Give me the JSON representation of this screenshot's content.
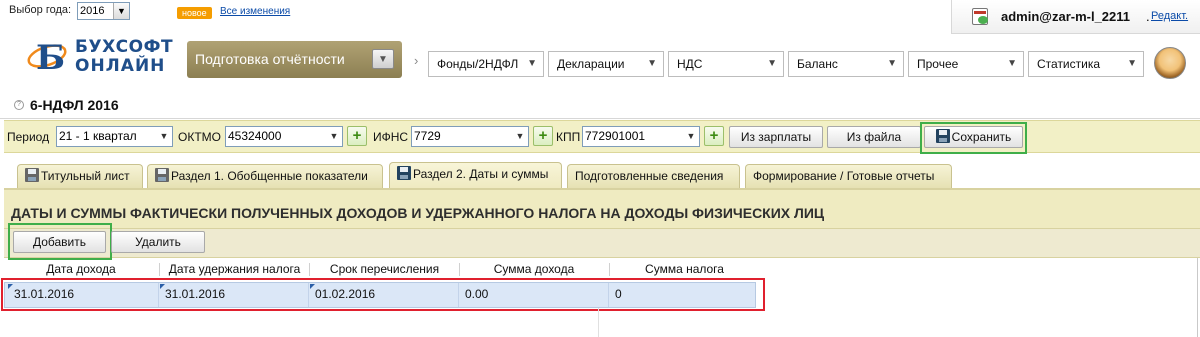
{
  "topbar": {
    "year_label": "Выбор года:",
    "year_value": "2016",
    "new_badge": "новое",
    "changes_link": "Все изменения"
  },
  "user": {
    "name": "admin@zar-m-l_2211",
    "separator": ".",
    "edit_link": "Редакт."
  },
  "logo": {
    "line1": "БУХСОФТ",
    "line2": "ОНЛАЙН"
  },
  "nav": {
    "report_button": "Подготовка отчётности",
    "chevron": "›",
    "items": [
      {
        "label": "Фонды/2НДФЛ"
      },
      {
        "label": "Декларации"
      },
      {
        "label": "НДС"
      },
      {
        "label": "Баланс"
      },
      {
        "label": "Прочее"
      },
      {
        "label": "Статистика"
      }
    ]
  },
  "page": {
    "title": "6-НДФЛ 2016"
  },
  "filters": {
    "period_label": "Период",
    "period_value": "21 - 1 квартал",
    "oktmo_label": "ОКТМО",
    "oktmo_value": "45324000",
    "ifns_label": "ИФНС",
    "ifns_value": "7729",
    "kpp_label": "КПП",
    "kpp_value": "772901001",
    "from_salary": "Из зарплаты",
    "from_file": "Из файла",
    "save": "Сохранить"
  },
  "tabs": [
    {
      "label": "Титульный лист",
      "active": false
    },
    {
      "label": "Раздел 1. Обобщенные показатели",
      "active": false
    },
    {
      "label": "Раздел 2. Даты и суммы",
      "active": true
    },
    {
      "label": "Подготовленные сведения",
      "active": false
    },
    {
      "label": "Формирование / Готовые отчеты",
      "active": false
    }
  ],
  "section": {
    "title": "ДАТЫ И СУММЫ ФАКТИЧЕСКИ ПОЛУЧЕННЫХ ДОХОДОВ И УДЕРЖАННОГО НАЛОГА НА ДОХОДЫ ФИЗИЧЕСКИХ ЛИЦ",
    "add_button": "Добавить",
    "delete_button": "Удалить"
  },
  "grid": {
    "columns": [
      "Дата дохода",
      "Дата удержания налога",
      "Срок перечисления",
      "Сумма дохода",
      "Сумма налога"
    ],
    "rows": [
      [
        "31.01.2016",
        "31.01.2016",
        "01.02.2016",
        "0.00",
        "0"
      ]
    ]
  },
  "colors": {
    "accent_yellow": "#efebc1",
    "highlight_green": "#3fae49",
    "highlight_red": "#e0202e",
    "link_blue": "#0b4ba8",
    "logo_blue": "#1f4e8a",
    "logo_orange": "#f08a1c"
  }
}
